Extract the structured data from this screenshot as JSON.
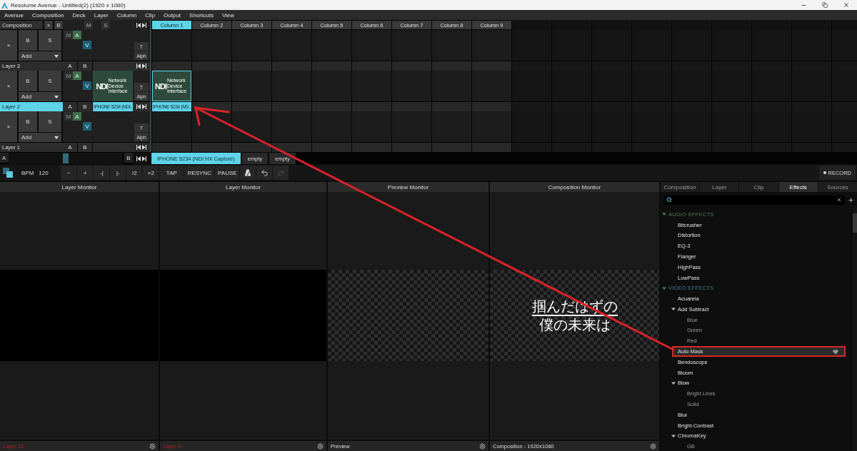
{
  "window": {
    "title": "Resolume Avenue - Untitled(2) (1920 x 1080)"
  },
  "menu": [
    "Avenue",
    "Composition",
    "Deck",
    "Layer",
    "Column",
    "Clip",
    "Output",
    "Shortcuts",
    "View"
  ],
  "composition_bar": {
    "label": "Composition",
    "buttons": [
      "×",
      "B"
    ],
    "layer_buttons": [
      "M",
      "S"
    ]
  },
  "columns": [
    {
      "label": "Column 1",
      "selected": true
    },
    {
      "label": "Column 2",
      "selected": false
    },
    {
      "label": "Column 3",
      "selected": false
    },
    {
      "label": "Column 4",
      "selected": false
    },
    {
      "label": "Column 5",
      "selected": false
    },
    {
      "label": "Column 6",
      "selected": false
    },
    {
      "label": "Column 7",
      "selected": false
    },
    {
      "label": "Column 8",
      "selected": false
    },
    {
      "label": "Column 9",
      "selected": false
    }
  ],
  "layers": [
    {
      "name": "Layer 3",
      "selected": false,
      "close": "×",
      "bypass": "B",
      "solo": "S",
      "blend": "Add",
      "toggles": [
        {
          "label": "M",
          "on": false
        },
        {
          "label": "A",
          "on": true
        },
        {
          "label": "V",
          "on": true
        }
      ],
      "crossfade": [
        "A",
        "B"
      ],
      "transform": [
        "T",
        "Alph"
      ]
    },
    {
      "name": "Layer 2",
      "selected": true,
      "close": "×",
      "bypass": "B",
      "solo": "S",
      "blend": "Add",
      "toggles": [
        {
          "label": "M",
          "on": false
        },
        {
          "label": "A",
          "on": true
        },
        {
          "label": "V",
          "on": true
        }
      ],
      "crossfade": [
        "A",
        "B"
      ],
      "transform": [
        "T",
        "Alph"
      ],
      "preview": {
        "label": "IPHONE 5234 (NDI...",
        "logo": "NDI",
        "logo_caption": "Network Device Interface"
      },
      "clips": [
        {
          "label": "IPHONE 5234 (ND...",
          "logo": "NDI",
          "logo_caption": "Network Device Interface",
          "selected": true
        }
      ]
    },
    {
      "name": "Layer 1",
      "selected": false,
      "close": "×",
      "bypass": "B",
      "solo": "S",
      "blend": "Add",
      "toggles": [
        {
          "label": "M",
          "on": false
        },
        {
          "label": "A",
          "on": true
        },
        {
          "label": "V",
          "on": true
        }
      ],
      "crossfade": [
        "A",
        "B"
      ],
      "transform": [
        "T",
        "Alph"
      ]
    }
  ],
  "crossfader": {
    "a_label": "A",
    "b_label": "B",
    "level": 0.5
  },
  "decks": [
    {
      "label": "IPHONE 5234 (NDI HX Capture)",
      "selected": true
    },
    {
      "label": "empty",
      "selected": false
    },
    {
      "label": "empty",
      "selected": false
    }
  ],
  "toolbar": {
    "bpm_label": "BPM",
    "bpm": "120",
    "buttons": [
      "−",
      "+",
      "-|",
      "|-",
      "/2",
      "×2",
      "TAP",
      "RESYNC",
      "PAUSE"
    ],
    "record": "RECORD"
  },
  "monitors": [
    {
      "title": "Layer Monitor",
      "footer": "Layer 12",
      "error": true,
      "kind": "black"
    },
    {
      "title": "Layer Monitor",
      "footer": "Layer 9",
      "error": true,
      "kind": "black"
    },
    {
      "title": "Preview Monitor",
      "footer": "Preview",
      "error": false,
      "kind": "transparent"
    },
    {
      "title": "Composition Monitor",
      "footer": "Composition - 1920x1080",
      "error": false,
      "kind": "transparent",
      "overlay_lines": [
        "掴んだはずの",
        "僕の未来は"
      ]
    }
  ],
  "panel": {
    "tabs": [
      {
        "label": "Composition",
        "selected": false
      },
      {
        "label": "Layer",
        "selected": false
      },
      {
        "label": "Clip",
        "selected": false
      },
      {
        "label": "Effects",
        "selected": true
      },
      {
        "label": "Sources",
        "selected": false
      }
    ],
    "tree": [
      {
        "label": "AUDIO EFFECTS",
        "kind": "category",
        "color": "#4f7d55",
        "expanded": true,
        "children": [
          {
            "label": "Bitcrusher",
            "kind": "effect",
            "highlighted": false
          },
          {
            "label": "Distortion",
            "kind": "effect",
            "highlighted": false
          },
          {
            "label": "EQ-3",
            "kind": "effect",
            "highlighted": false
          },
          {
            "label": "Flanger",
            "kind": "effect",
            "highlighted": false
          },
          {
            "label": "HighPass",
            "kind": "effect",
            "highlighted": false
          },
          {
            "label": "LowPass",
            "kind": "effect",
            "highlighted": false
          }
        ]
      },
      {
        "label": "VIDEO EFFECTS",
        "kind": "category",
        "color": "#3b7d8c",
        "expanded": true,
        "children": [
          {
            "label": "Acuarela",
            "kind": "effect",
            "highlighted": false
          },
          {
            "label": "Add Subtract",
            "kind": "group",
            "expanded": true,
            "children": [
              {
                "label": "Blue",
                "kind": "effect",
                "highlighted": false
              },
              {
                "label": "Green",
                "kind": "effect",
                "highlighted": false
              },
              {
                "label": "Red",
                "kind": "effect",
                "highlighted": false
              }
            ]
          },
          {
            "label": "Auto Mask",
            "kind": "effect",
            "highlighted": true
          },
          {
            "label": "Bendoscope",
            "kind": "effect",
            "highlighted": false
          },
          {
            "label": "Bloom",
            "kind": "effect",
            "highlighted": false
          },
          {
            "label": "Blow",
            "kind": "group",
            "expanded": true,
            "children": [
              {
                "label": "Bright Lines",
                "kind": "effect",
                "highlighted": false
              },
              {
                "label": "Solid",
                "kind": "effect",
                "highlighted": false
              }
            ]
          },
          {
            "label": "Blur",
            "kind": "effect",
            "highlighted": false
          },
          {
            "label": "Bright.Contrast",
            "kind": "effect",
            "highlighted": false
          },
          {
            "label": "ChromaKey",
            "kind": "group",
            "expanded": true,
            "children": [
              {
                "label": "GB",
                "kind": "effect",
                "highlighted": false
              }
            ]
          }
        ]
      }
    ]
  }
}
